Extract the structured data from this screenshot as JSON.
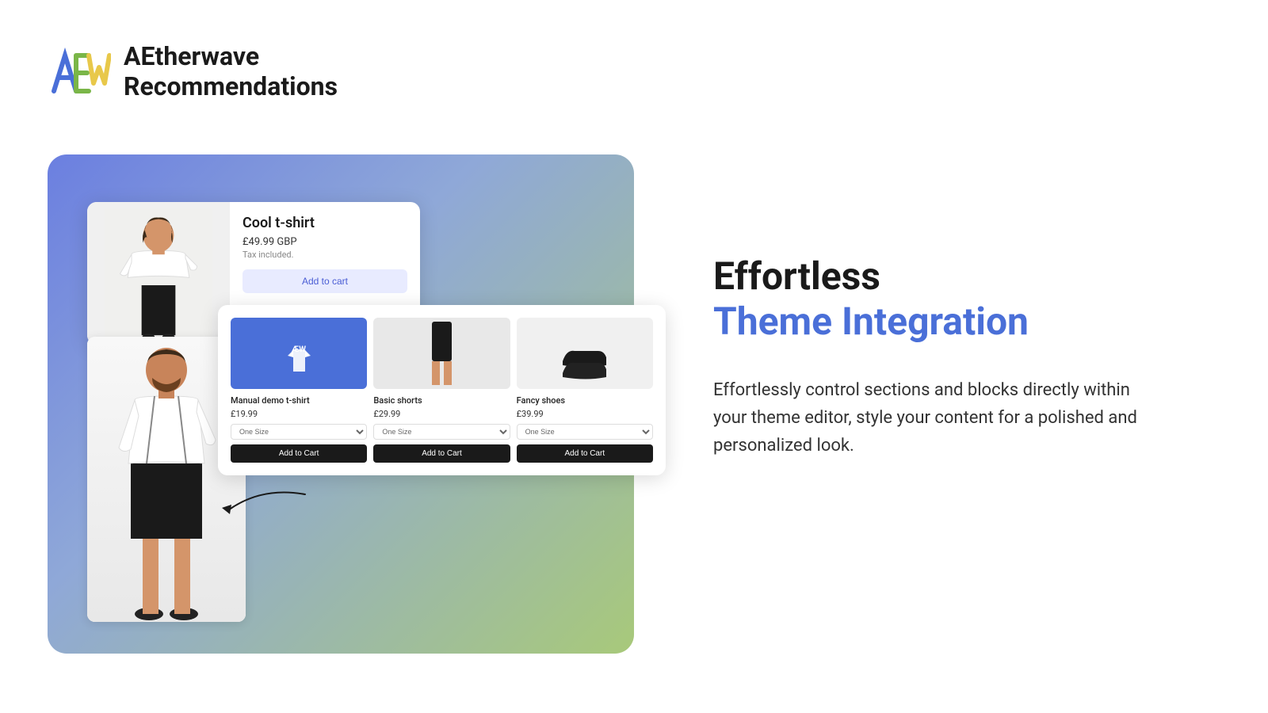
{
  "logo": {
    "name": "AEtherwave",
    "subtitle": "Recommendations"
  },
  "main_product": {
    "name": "Cool t-shirt",
    "price": "£49.99 GBP",
    "tax": "Tax included.",
    "add_to_cart": "Add to cart"
  },
  "recommended_products": [
    {
      "name": "Manual demo t-shirt",
      "price": "£19.99",
      "size_placeholder": "One Size",
      "btn_label": "Add to Cart",
      "img_type": "tshirt"
    },
    {
      "name": "Basic shorts",
      "price": "£29.99",
      "size_placeholder": "One Size",
      "btn_label": "Add to Cart",
      "img_type": "shorts"
    },
    {
      "name": "Fancy shoes",
      "price": "£39.99",
      "size_placeholder": "One Size",
      "btn_label": "Add to Cart",
      "img_type": "shoes"
    }
  ],
  "feature": {
    "headline_black": "Effortless",
    "headline_blue": "Theme Integration",
    "description": "Effortlessly control sections and blocks directly within your theme editor, style your content for a polished and personalized look."
  },
  "colors": {
    "blue_accent": "#4a6fd8",
    "gradient_start": "#6b7fe0",
    "gradient_end": "#a8c97a"
  }
}
